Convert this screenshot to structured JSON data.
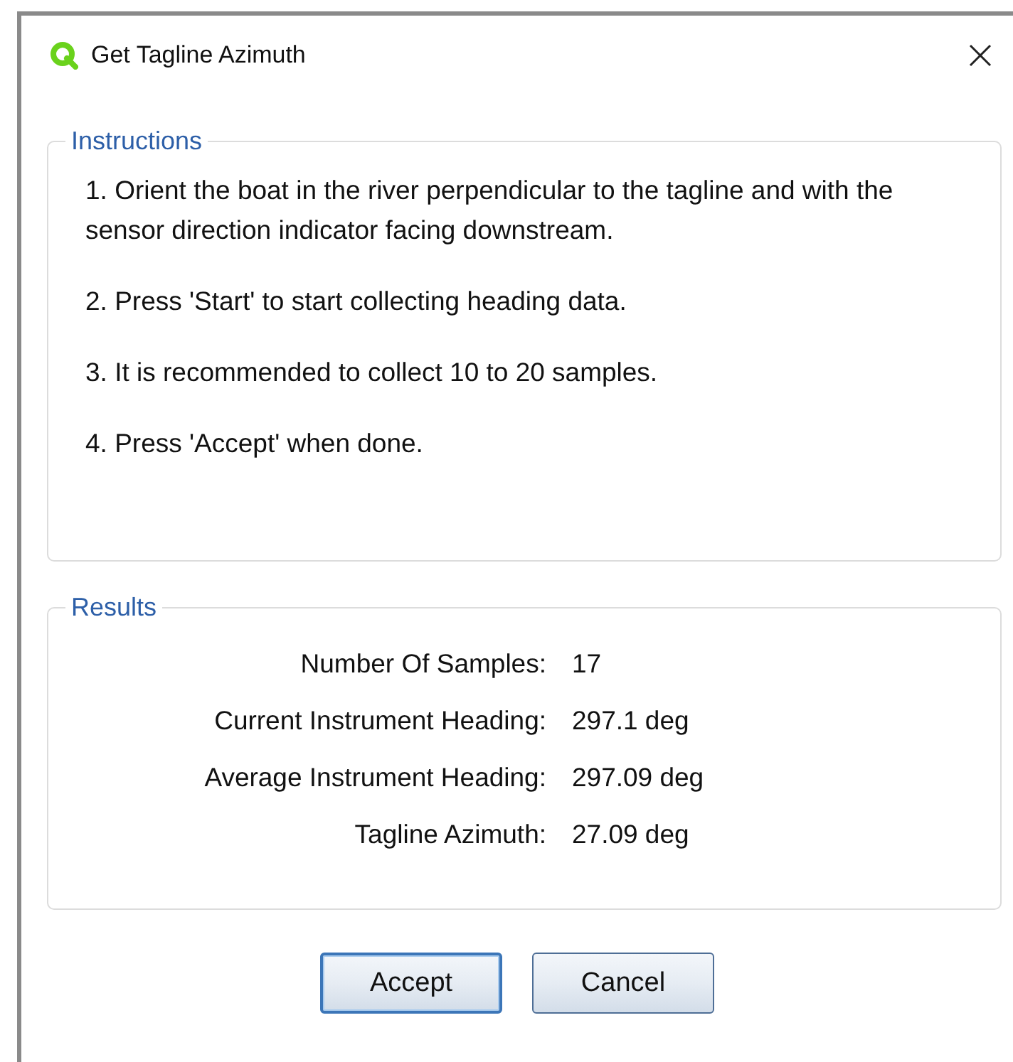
{
  "window": {
    "title": "Get Tagline Azimuth"
  },
  "instructions": {
    "title": "Instructions",
    "steps": [
      "1. Orient the boat in the river perpendicular to the tagline and with the sensor direction indicator facing downstream.",
      "2. Press 'Start' to start collecting heading data.",
      "3. It is recommended to collect 10 to 20 samples.",
      "4. Press 'Accept' when done."
    ]
  },
  "results": {
    "title": "Results",
    "rows": [
      {
        "label": "Number Of Samples:",
        "value": "17"
      },
      {
        "label": "Current Instrument Heading:",
        "value": "297.1 deg"
      },
      {
        "label": "Average Instrument Heading:",
        "value": "297.09 deg"
      },
      {
        "label": "Tagline Azimuth:",
        "value": "27.09 deg"
      }
    ]
  },
  "buttons": [
    {
      "label": "Accept",
      "default": true
    },
    {
      "label": "Cancel",
      "default": false
    }
  ]
}
